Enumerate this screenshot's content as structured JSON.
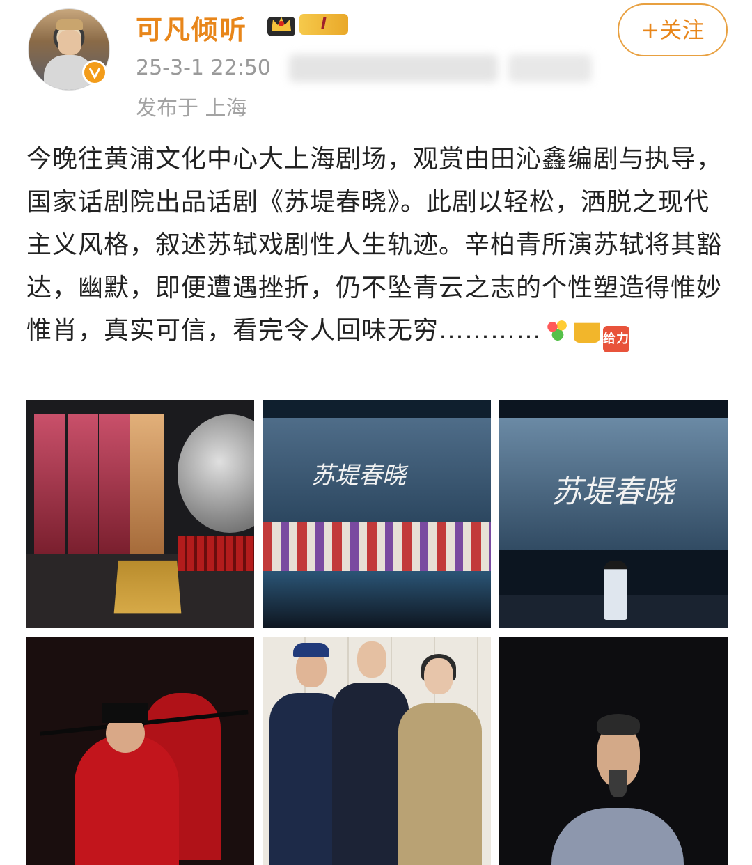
{
  "user": {
    "name": "可凡倾听",
    "level": "I",
    "follow_label": "+关注",
    "avatar_icon": "avatar-photo",
    "verified_icon": "verified-v-icon"
  },
  "post_meta": {
    "time": "25-3-1 22:50",
    "location": "发布于 上海"
  },
  "post": {
    "text": "今晚往黄浦文化中心大上海剧场，观赏由田沁鑫编剧与执导，国家话剧院出品话剧《苏堤春晓》。此剧以轻松，洒脱之现代主义风格，叙述苏轼戏剧性人生轨迹。辛柏青所演苏轼将其豁达，幽默，即便遭遇挫折，仍不坠青云之志的个性塑造得惟妙惟肖，真实可信，看完令人回味无穷…………",
    "emojis": [
      "flower-emoji",
      "beer-emoji",
      "geili-emoji"
    ],
    "geili_text": "给力"
  },
  "photos": {
    "stage_title": "苏堤春晓"
  },
  "colors": {
    "name": "#e8861a",
    "follow_border": "#e8a040",
    "meta": "#9a9a9a",
    "text": "#222222"
  }
}
